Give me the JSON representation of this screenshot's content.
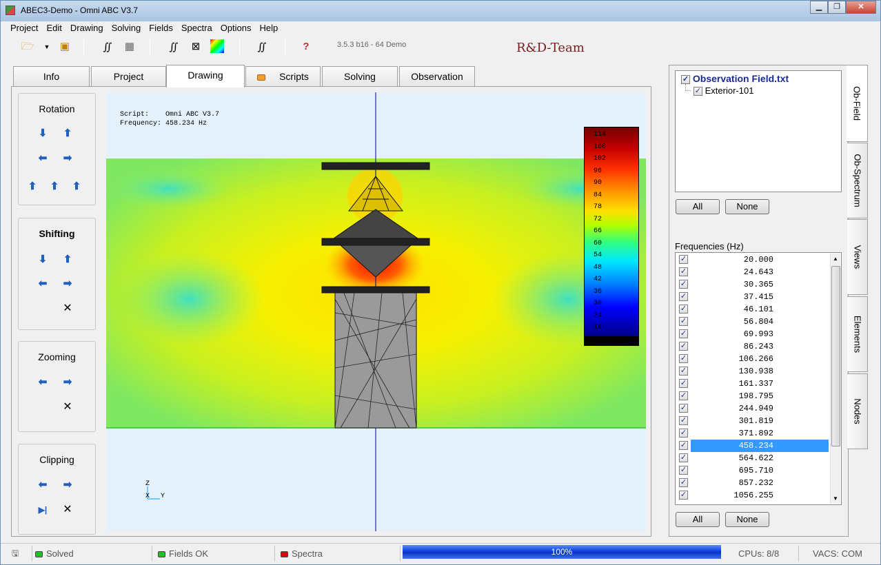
{
  "window": {
    "title": "ABEC3-Demo - Omni ABC V3.7",
    "min": "▁",
    "max": "❐",
    "close": "✕"
  },
  "menu": [
    "Project",
    "Edit",
    "Drawing",
    "Solving",
    "Fields",
    "Spectra",
    "Options",
    "Help"
  ],
  "toolbar": {
    "version": "3.5.3 b16 - 64 Demo",
    "brand": "R&D-Team"
  },
  "tabs": [
    "Info",
    "Project",
    "Drawing",
    "Scripts",
    "Solving",
    "Observation"
  ],
  "active_tab": "Drawing",
  "left_panel": {
    "rotation": "Rotation",
    "shifting": "Shifting",
    "zooming": "Zooming",
    "clipping": "Clipping"
  },
  "drawing": {
    "script_line": "Script:    Omni ABC V3.7",
    "freq_line": "Frequency: 458.234 Hz",
    "legend_labels": [
      "114",
      "108",
      "102",
      "96",
      "90",
      "84",
      "78",
      "72",
      "66",
      "60",
      "54",
      "48",
      "42",
      "36",
      "30",
      "24",
      "18"
    ],
    "axis_z": "Z",
    "axis_x": "X",
    "axis_y": "Y"
  },
  "observation": {
    "root": "Observation Field.txt",
    "child": "Exterior-101",
    "all_label": "All",
    "none_label": "None",
    "freq_title": "Frequencies  (Hz)",
    "frequencies": [
      "20.000",
      "24.643",
      "30.365",
      "37.415",
      "46.101",
      "56.804",
      "69.993",
      "86.243",
      "106.266",
      "130.938",
      "161.337",
      "198.795",
      "244.949",
      "301.819",
      "371.892",
      "458.234",
      "564.622",
      "695.710",
      "857.232",
      "1056.255"
    ],
    "selected": "458.234"
  },
  "side_tabs": [
    "Ob-Field",
    "Ob-Spectrum",
    "Views",
    "Elements",
    "Nodes"
  ],
  "status": {
    "solved": "Solved",
    "fields": "Fields OK",
    "spectra": "Spectra",
    "progress": "100%",
    "cpus": "CPUs: 8/8",
    "vacs": "VACS: COM"
  }
}
